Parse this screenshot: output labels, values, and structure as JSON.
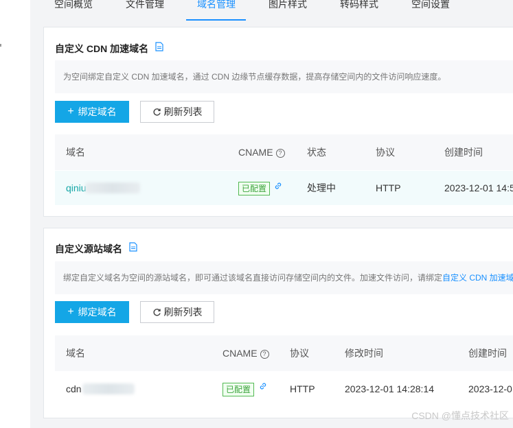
{
  "tabs": [
    {
      "label": "空间概览"
    },
    {
      "label": "文件管理"
    },
    {
      "label": "域名管理"
    },
    {
      "label": "图片样式"
    },
    {
      "label": "转码样式"
    },
    {
      "label": "空间设置"
    }
  ],
  "cdn_section": {
    "title": "自定义 CDN 加速域名",
    "description": "为空间绑定自定义 CDN 加速域名，通过 CDN 边缘节点缓存数据，提高存储空间内的文件访问响应速度。",
    "bind_button": "绑定域名",
    "refresh_button": "刷新列表",
    "columns": [
      "域名",
      "CNAME",
      "状态",
      "协议",
      "创建时间"
    ],
    "row": {
      "domain": "qiniu",
      "cname": "已配置",
      "status": "处理中",
      "protocol": "HTTP",
      "created": "2023-12-01 14:5"
    }
  },
  "origin_section": {
    "title": "自定义源站域名",
    "description": "绑定自定义域名为空间的源站域名，即可通过该域名直接访问存储空间内的文件。加速文件访问，请绑定",
    "description_link": "自定义 CDN 加速域",
    "bind_button": "绑定域名",
    "refresh_button": "刷新列表",
    "columns": [
      "域名",
      "CNAME",
      "协议",
      "修改时间",
      "创建时间"
    ],
    "row": {
      "domain": "cdn",
      "cname": "已配置",
      "protocol": "HTTP",
      "modified": "2023-12-01 14:28:14",
      "created": "2023-12-0"
    }
  },
  "watermark": "CSDN @懂点技术社区",
  "colors": {
    "accent": "#1990ff",
    "primary_button": "#14a6e6",
    "success": "#3da33d"
  }
}
